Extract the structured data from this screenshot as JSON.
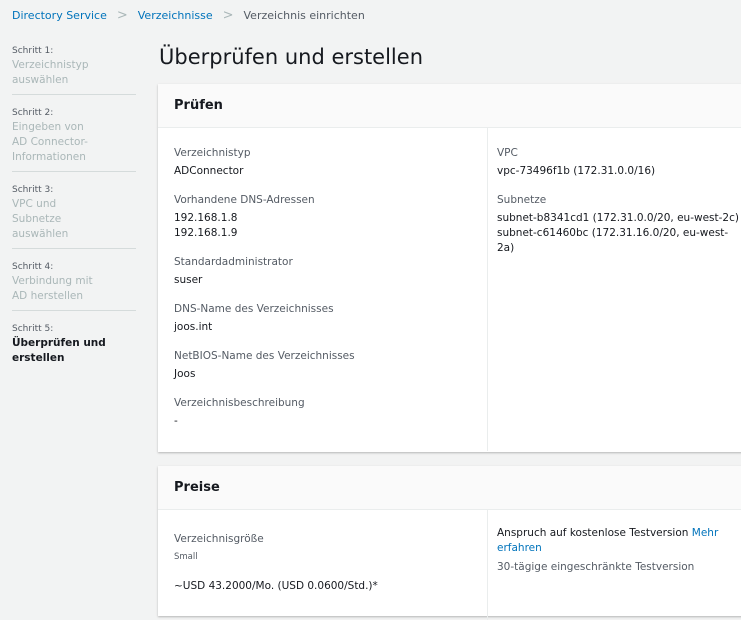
{
  "breadcrumb": [
    "Directory Service",
    "Verzeichnisse",
    "Verzeichnis einrichten"
  ],
  "steps": [
    {
      "num": "Schritt 1:",
      "label": "Verzeichnistyp auswählen"
    },
    {
      "num": "Schritt 2:",
      "label": "Eingeben von AD Connector-Informationen"
    },
    {
      "num": "Schritt 3:",
      "label": "VPC und Subnetze auswählen"
    },
    {
      "num": "Schritt 4:",
      "label": "Verbindung mit AD herstellen"
    },
    {
      "num": "Schritt 5:",
      "label": "Überprüfen und erstellen"
    }
  ],
  "title": "Überprüfen und erstellen",
  "review": {
    "header": "Prüfen",
    "type_label": "Verzeichnistyp",
    "type": "ADConnector",
    "dns_label": "Vorhandene DNS-Adressen",
    "dns": [
      "192.168.1.8",
      "192.168.1.9"
    ],
    "admin_label": "Standardadministrator",
    "admin": "suser",
    "dnsname_label": "DNS-Name des Verzeichnisses",
    "dnsname": "joos.int",
    "netbios_label": "NetBIOS-Name des Verzeichnisses",
    "netbios": "Joos",
    "desc_label": "Verzeichnisbeschreibung",
    "desc": "-",
    "vpc_label": "VPC",
    "vpc": "vpc-73496f1b (172.31.0.0/16)",
    "subnets_label": "Subnetze",
    "subnets": [
      "subnet-b8341cd1 (172.31.0.0/20, eu-west-2c)",
      "subnet-c61460bc (172.31.16.0/20, eu-west-2a)"
    ]
  },
  "pricing": {
    "header": "Preise",
    "size_label": "Verzeichnisgröße",
    "size": "Small",
    "price": "~USD 43.2000/Mo. (USD 0.0600/Std.)*",
    "trial": "Anspruch auf kostenlose Testversion",
    "learn_more": "Mehr erfahren",
    "trial_desc": "30-tägige eingeschränkte Testversion"
  }
}
